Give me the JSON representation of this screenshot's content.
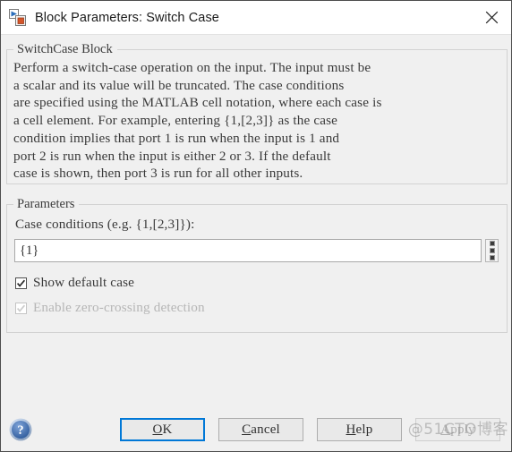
{
  "window": {
    "title": "Block Parameters: Switch Case",
    "icon": "simulink-block-icon",
    "close_icon": "close-icon"
  },
  "description_group": {
    "legend": "SwitchCase Block",
    "text": "Perform a switch-case operation on the input.  The input must be\na scalar and its value will be truncated.  The case conditions\nare specified using the MATLAB cell notation, where each case is\na cell element.  For example, entering {1,[2,3]} as the case\ncondition implies that port 1 is run when the input is 1 and\nport 2 is run when the input is either 2 or 3.  If the default\ncase is shown, then port 3 is run for all other inputs."
  },
  "parameters_group": {
    "legend": "Parameters",
    "case_conditions": {
      "label": "Case conditions (e.g. {1,[2,3]}):",
      "value": "{1}",
      "placeholder": "",
      "more_button_icon": "vertical-dots-icon"
    },
    "checkboxes": [
      {
        "label": "Show default case",
        "checked": true,
        "enabled": true
      },
      {
        "label": "Enable zero-crossing detection",
        "checked": true,
        "enabled": false
      }
    ]
  },
  "footer": {
    "help_icon": "question-mark-icon",
    "buttons": [
      {
        "label": "OK",
        "mnemonic": "O",
        "state": "focused"
      },
      {
        "label": "Cancel",
        "mnemonic": "C",
        "state": "normal"
      },
      {
        "label": "Help",
        "mnemonic": "H",
        "state": "normal"
      },
      {
        "label": "Apply",
        "mnemonic": "A",
        "state": "disabled"
      }
    ]
  },
  "watermark": {
    "text": "@51CTO博客"
  },
  "colors": {
    "dialog_background": "#f0f0f0",
    "titlebar_background": "#ffffff",
    "group_border": "#d2d2d2",
    "text": "#3a3a3a",
    "focus_blue": "#0078d7",
    "disabled_text": "#b2b2b2",
    "icon_blue": "#2a6ebb",
    "icon_orange": "#d4552a"
  }
}
